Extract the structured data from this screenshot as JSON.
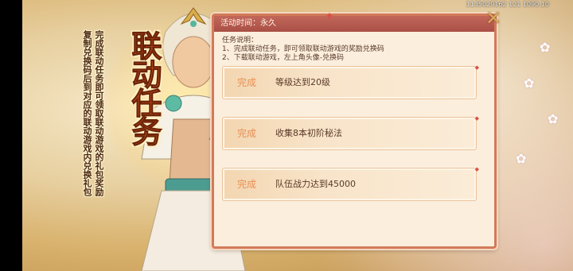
{
  "watermark": "1135029162 121 1090.10",
  "promo": {
    "title": "联动任务",
    "description": "完成联动任务即可领取联动游戏的礼包奖励 复制兑换码后到对应的联动游戏内兑换礼包"
  },
  "panel": {
    "activity_time": "活动时间：永久",
    "rules_title": "任务说明：",
    "rules": [
      "1、完成联动任务，即可领取联动游戏的奖励兑换码",
      "2、下载联动游戏，左上角头像-兑换码"
    ],
    "tasks": [
      {
        "status": "完成",
        "description": "等级达到20级"
      },
      {
        "status": "完成",
        "description": "收集8本初阶秘法"
      },
      {
        "status": "完成",
        "description": "队伍战力达到45000"
      }
    ]
  },
  "icons": {
    "close": "close-icon",
    "knot": "knot-ornament-icon",
    "blossom": "blossom-icon"
  },
  "colors": {
    "title": "#d4531c",
    "header": "#b15649",
    "status": "#e88f53",
    "panel_border": "#d27a5a"
  }
}
